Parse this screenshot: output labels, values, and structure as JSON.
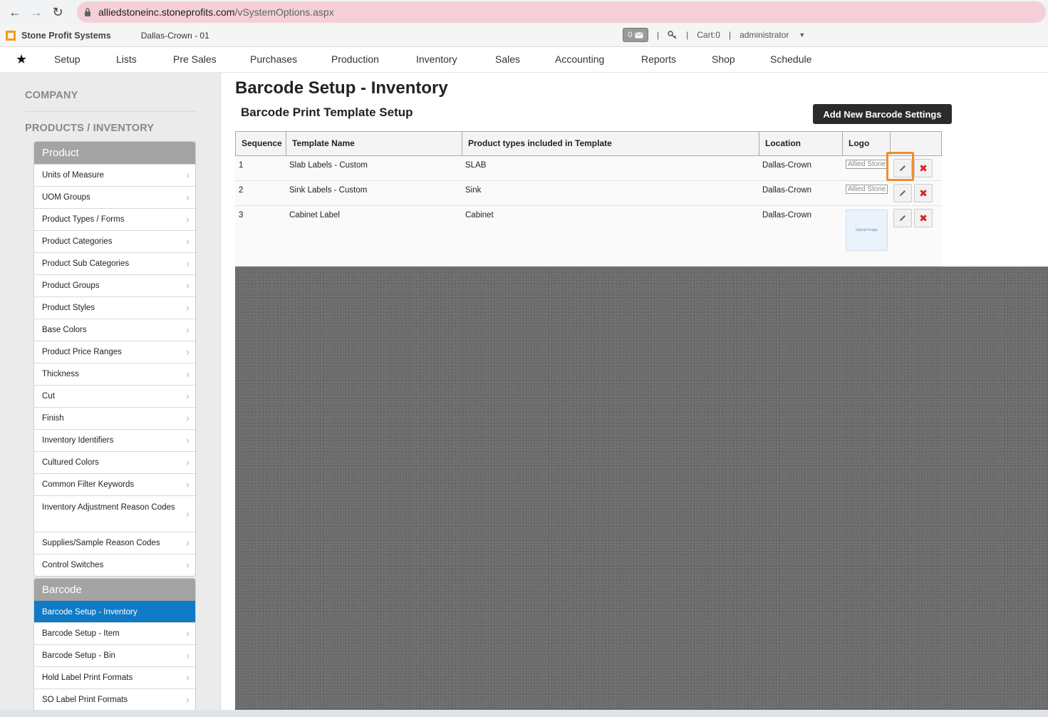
{
  "browser": {
    "url_host": "alliedstoneinc.stoneprofits.com",
    "url_path": "/vSystemOptions.aspx"
  },
  "header": {
    "brand": "Stone Profit Systems",
    "company": "Dallas-Crown - 01",
    "messages": "0",
    "cart": "Cart:0",
    "user": "administrator"
  },
  "nav": {
    "items": [
      "Setup",
      "Lists",
      "Pre Sales",
      "Purchases",
      "Production",
      "Inventory",
      "Sales",
      "Accounting",
      "Reports",
      "Shop",
      "Schedule"
    ]
  },
  "sidebar": {
    "section_company": "COMPANY",
    "section_products": "PRODUCTS / INVENTORY",
    "product_panel": {
      "title": "Product",
      "items": [
        "Units of Measure",
        "UOM Groups",
        "Product Types / Forms",
        "Product Categories",
        "Product Sub Categories",
        "Product Groups",
        "Product Styles",
        "Base Colors",
        "Product Price Ranges",
        "Thickness",
        "Cut",
        "Finish",
        "Inventory Identifiers",
        "Cultured Colors",
        "Common Filter Keywords",
        "Inventory Adjustment Reason Codes",
        "Supplies/Sample Reason Codes",
        "Control Switches"
      ]
    },
    "barcode_panel": {
      "title": "Barcode",
      "items": [
        "Barcode Setup - Inventory",
        "Barcode Setup - Item",
        "Barcode Setup - Bin",
        "Hold Label Print Formats",
        "SO Label Print Formats"
      ]
    }
  },
  "main": {
    "title": "Barcode Setup - Inventory",
    "subtitle": "Barcode Print Template Setup",
    "add_button": "Add New Barcode Settings",
    "columns": [
      "Sequence",
      "Template Name",
      "Product types included in Template",
      "Location",
      "Logo"
    ],
    "rows": [
      {
        "sequence": "1",
        "template": "Slab Labels - Custom",
        "types": "SLAB",
        "location": "Dallas-Crown",
        "logo": "Allied Stone"
      },
      {
        "sequence": "2",
        "template": "Sink Labels - Custom",
        "types": "Sink",
        "location": "Dallas-Crown",
        "logo": "Allied Stone"
      },
      {
        "sequence": "3",
        "template": "Cabinet Label",
        "types": "Cabinet",
        "location": "Dallas-Crown",
        "logo": "Upload Image"
      }
    ]
  }
}
